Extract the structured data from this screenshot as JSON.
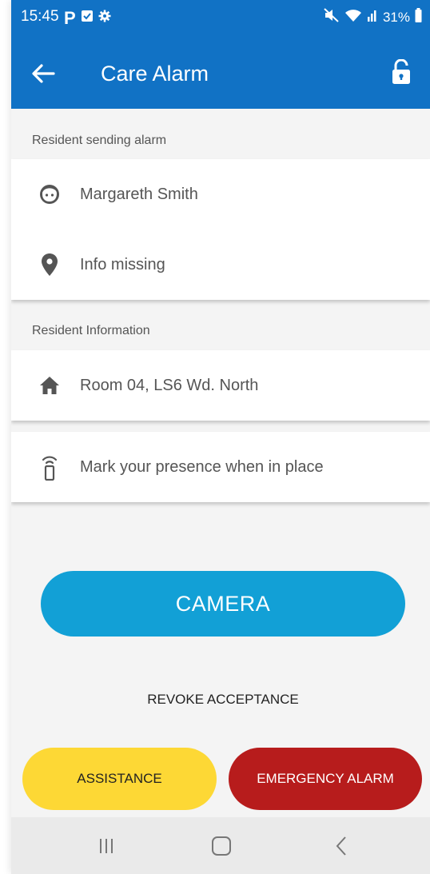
{
  "status_bar": {
    "time": "15:45",
    "battery": "31%"
  },
  "app_bar": {
    "title": "Care Alarm"
  },
  "sections": {
    "sending": {
      "header": "Resident sending alarm",
      "resident_name": "Margareth Smith",
      "location": "Info missing"
    },
    "info": {
      "header": "Resident Information",
      "room": "Room 04, LS6 Wd. North",
      "presence": "Mark your presence when in place"
    }
  },
  "actions": {
    "camera": "CAMERA",
    "revoke": "REVOKE ACCEPTANCE",
    "assistance": "ASSISTANCE",
    "emergency": "EMERGENCY ALARM"
  },
  "colors": {
    "primary": "#1172c5",
    "camera": "#12a0d6",
    "assistance": "#fdd835",
    "emergency": "#b71c1c"
  },
  "icons": {
    "back": "arrow-left-icon",
    "lock": "unlocked-padlock-icon",
    "resident": "face-icon",
    "location": "location-pin-icon",
    "room": "home-icon",
    "presence": "remote-signal-icon"
  }
}
